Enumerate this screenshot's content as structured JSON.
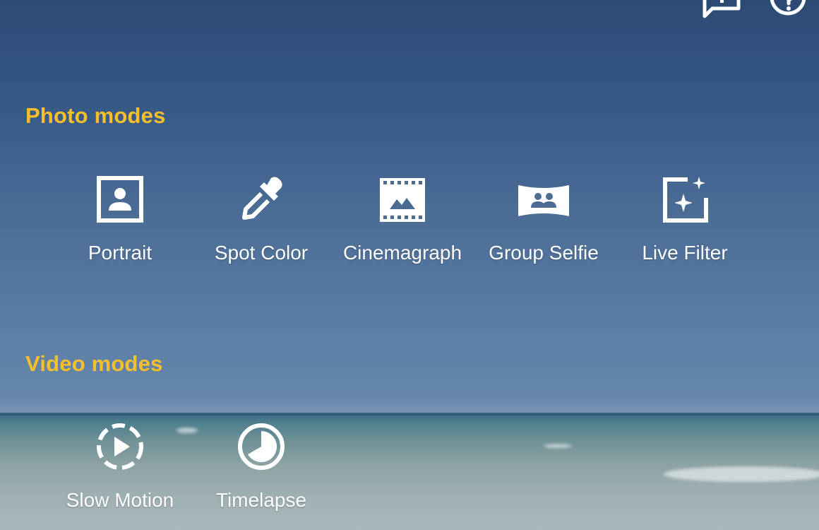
{
  "top_icons": [
    "feedback-icon",
    "help-icon"
  ],
  "photo_section": {
    "title": "Photo modes",
    "modes": [
      {
        "label": "Portrait",
        "icon": "portrait-icon"
      },
      {
        "label": "Spot Color",
        "icon": "eyedropper-icon"
      },
      {
        "label": "Cinemagraph",
        "icon": "film-icon"
      },
      {
        "label": "Group Selfie",
        "icon": "group-icon"
      },
      {
        "label": "Live Filter",
        "icon": "sparkle-frame-icon"
      }
    ]
  },
  "video_section": {
    "title": "Video modes",
    "modes": [
      {
        "label": "Slow Motion",
        "icon": "slow-motion-icon"
      },
      {
        "label": "Timelapse",
        "icon": "timelapse-icon"
      }
    ]
  },
  "colors": {
    "section_title": "#f5c02b",
    "label": "#ffffff"
  }
}
